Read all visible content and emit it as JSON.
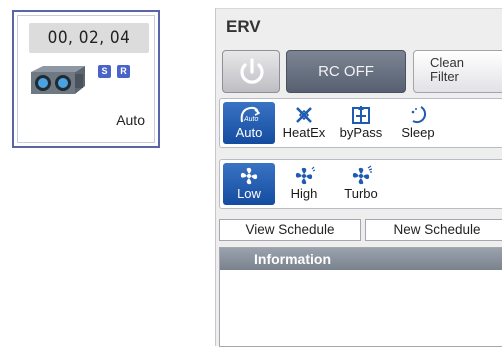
{
  "device_tile": {
    "time": "00, 02, 04",
    "badges": [
      "S",
      "R"
    ],
    "mode": "Auto",
    "unit_icon": "erv-unit-icon",
    "border_color": "#5a64a8"
  },
  "erv_panel": {
    "title": "ERV",
    "power_icon": "power-icon",
    "rc_button": "RC OFF",
    "clean_filter": [
      "Clean",
      "Filter"
    ],
    "modes": [
      {
        "label": "Auto",
        "icon": "auto-mode-icon",
        "active": true
      },
      {
        "label": "HeatEx",
        "icon": "heat-exchange-icon",
        "active": false
      },
      {
        "label": "byPass",
        "icon": "bypass-icon",
        "active": false
      },
      {
        "label": "Sleep",
        "icon": "sleep-icon",
        "active": false
      }
    ],
    "fan_speeds": [
      {
        "label": "Low",
        "icon": "fan-icon",
        "active": true
      },
      {
        "label": "High",
        "icon": "fan-icon",
        "active": false
      },
      {
        "label": "Turbo",
        "icon": "fan-icon",
        "active": false
      }
    ],
    "schedule_tabs": [
      "View Schedule",
      "New Schedule"
    ],
    "information_header": "Information",
    "accent_color": "#1f5bb0"
  }
}
